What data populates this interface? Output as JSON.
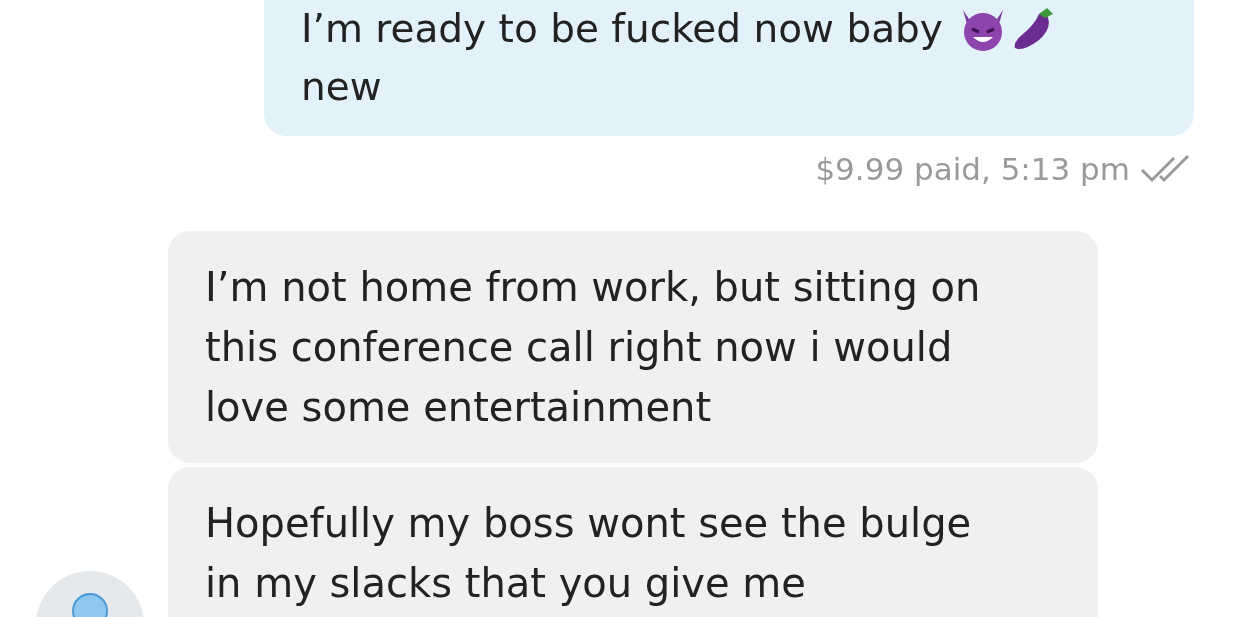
{
  "messages": [
    {
      "kind": "sent",
      "text": "I’m ready to be fucked now baby",
      "emoji": [
        {
          "kind": "devil"
        },
        {
          "kind": "eggplant"
        }
      ],
      "text_2": "new",
      "meta": "$9.99 paid, 5:13 pm",
      "read": true
    },
    {
      "kind": "received",
      "text": "I’m not home from work, but sitting on this conference call right now i would love some entertainment"
    },
    {
      "kind": "received",
      "text": "Hopefully my boss wont see the bulge in my slacks that you give me",
      "avatar": true
    }
  ]
}
